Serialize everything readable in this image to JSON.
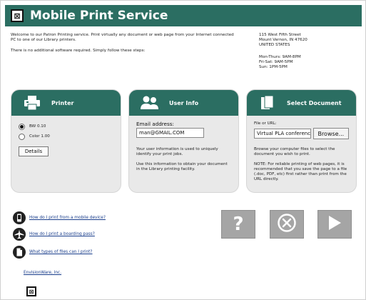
{
  "header": {
    "title": "Mobile Print Service",
    "logo_glyph": "⊠"
  },
  "intro": {
    "line1": "Welcome to our Patron Printing service. Print virtually any document or web page from your Internet connected PC to one of our Library printers.",
    "line2": "There is no additional software required. Simply follow these steps:"
  },
  "address": {
    "street": "115 West Fifth Street",
    "city": "Mount Vernon, IN  47620",
    "country": "UNITED STATES",
    "hours1": "Mon-Thurs: 9AM-8PM",
    "hours2": "Fri-Sat: 9AM-5PM",
    "hours3": "Sun: 1PM-5PM"
  },
  "printer": {
    "title": "Printer",
    "option1": "BW 0.10",
    "option2": "Color 1.00",
    "selected": "BW 0.10",
    "details_label": "Details"
  },
  "userinfo": {
    "title": "User Info",
    "email_label": "Email address:",
    "email_value": "man@GMAIL.COM",
    "note1": "Your user information is used to uniquely identify your print jobs.",
    "note2": "Use this information to obtain your document in the Library printing facility."
  },
  "document": {
    "title": "Select Document",
    "file_label": "File or URL:",
    "file_value": "Virtual PLA conferenc",
    "browse_label": "Browse...",
    "note1": "Browse your computer files to select the document you wish to print.",
    "note2": "NOTE: For reliable printing of web pages, it is recommended that you save the page to a file (.doc, PDF, etc) first rather than print from the URL directly."
  },
  "links": {
    "mobile": "How do I print from a mobile device?",
    "boarding": "How do I print a boarding pass?",
    "filetypes": "What types of files can I print?"
  },
  "footer": {
    "company": "EnvisionWare, Inc.",
    "logo_glyph": "⊠"
  },
  "colors": {
    "brand": "#2b6e62",
    "panel_bg": "#e9e9e9",
    "action_gray": "#a5a5a5",
    "link": "#1a3e8c"
  },
  "icons": [
    "printer-icon",
    "users-icon",
    "document-icon",
    "mobile-icon",
    "plane-icon",
    "file-icon",
    "help-icon",
    "cancel-icon",
    "next-icon"
  ]
}
